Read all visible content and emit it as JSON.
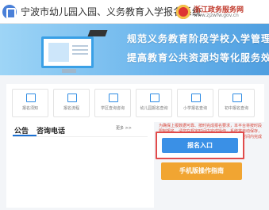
{
  "header": {
    "title": "宁波市幼儿园入园、义务教育入学报名系统",
    "gov_name": "浙江政务服务网",
    "gov_url": "www.zjzwfw.gov.cn"
  },
  "banner": {
    "line1": "规范义务教育阶段学校入学管理",
    "line2": "提高教育公共资源均等化服务效率"
  },
  "services": [
    {
      "label": "报名须知"
    },
    {
      "label": "报名流程"
    },
    {
      "label": "学区查询咨询"
    },
    {
      "label": "幼儿园报名查询"
    },
    {
      "label": "小学报名查询"
    },
    {
      "label": "初中报名查询"
    }
  ],
  "tabs": {
    "announcement": "公告",
    "phone": "咨询电话",
    "more": "更多 >>"
  },
  "notice": "为确保上报数据可靠、按时完成报名要求，本平台将按时段限制报名，请您在规定时间内完成操作，系统将自动保存，若有疑问请与所属学校或教育局联系，并在规定时间内完成报名操作。",
  "buttons": {
    "register": "报名入口",
    "mobile": "手机版操作指南"
  },
  "colors": {
    "primary": "#3a90e6",
    "highlight_border": "#e14b4b",
    "secondary": "#f1a532"
  }
}
